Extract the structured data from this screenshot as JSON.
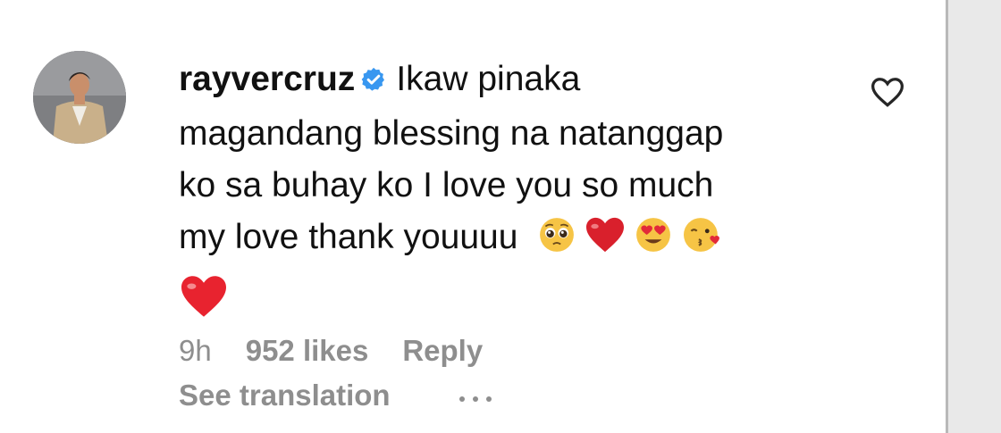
{
  "comment": {
    "username": "rayvercruz",
    "verified": true,
    "text_lines": [
      "Ikaw pinaka",
      "magandang blessing na natanggap",
      "ko sa buhay ko I love you so much",
      "my love thank youuuu"
    ],
    "emojis": [
      "pleading-face",
      "red-heart",
      "heart-eyes-face",
      "kissing-heart-face",
      "red-heart"
    ]
  },
  "meta": {
    "time": "9h",
    "likes": "952 likes",
    "reply": "Reply",
    "see_translation": "See translation"
  },
  "icons": {
    "like": "heart-outline-icon",
    "more": "ellipsis-icon",
    "verified": "verified-badge-icon"
  },
  "colors": {
    "verified_blue": "#3897f0",
    "secondary_text": "#8e8e8e",
    "heart_red": "#e0202e"
  }
}
